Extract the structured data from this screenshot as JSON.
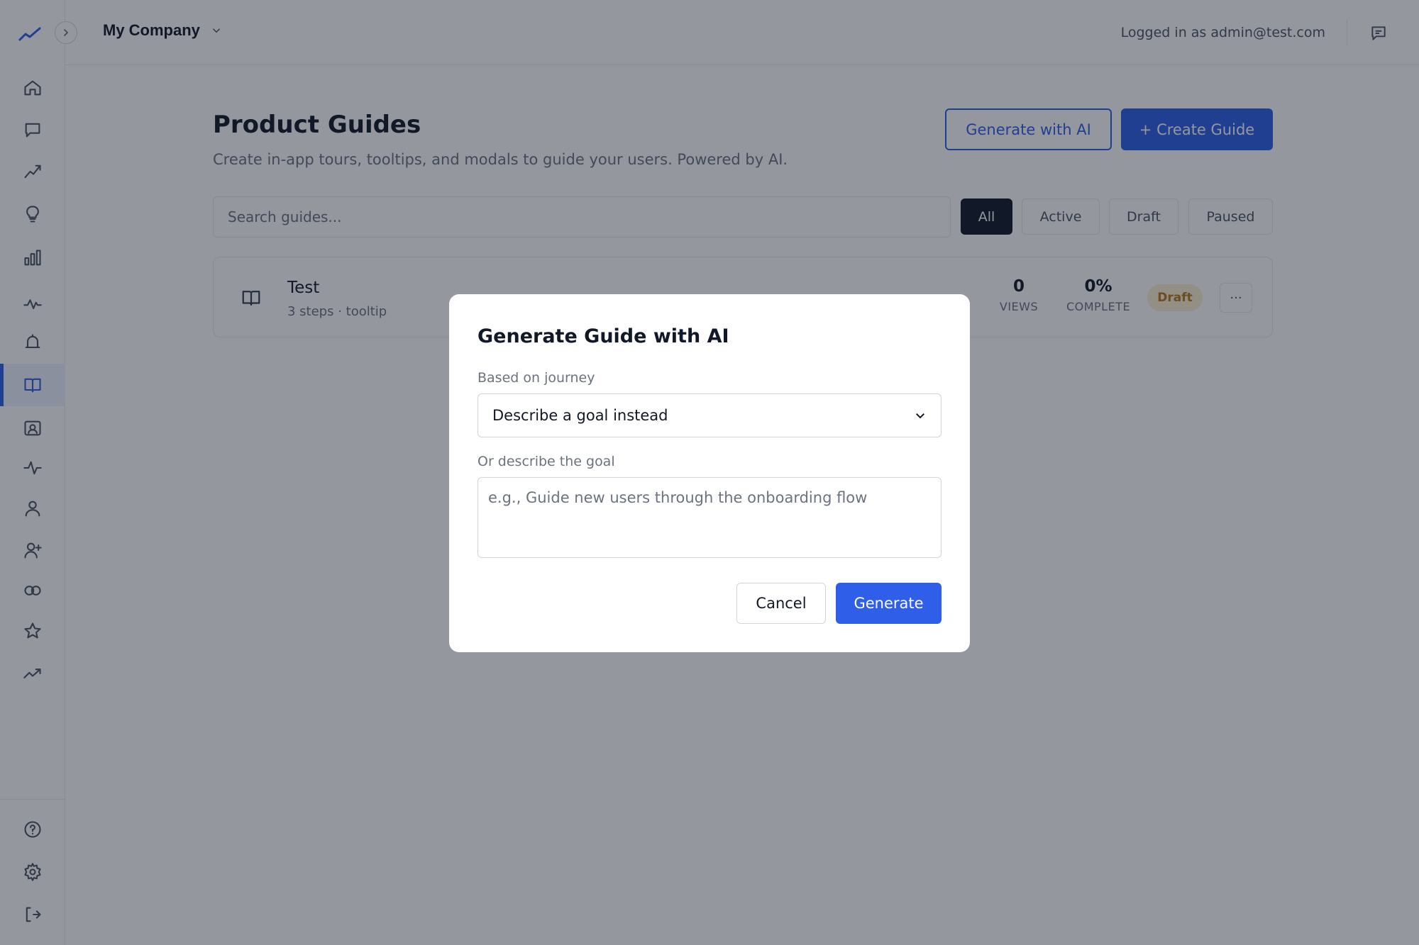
{
  "topbar": {
    "company": "My Company",
    "logged_in": "Logged in as admin@test.com"
  },
  "page": {
    "title": "Product Guides",
    "subtitle": "Create in-app tours, tooltips, and modals to guide your users. Powered by AI.",
    "generate_ai_label": "Generate with AI",
    "create_label": "+ Create Guide",
    "search_placeholder": "Search guides..."
  },
  "filters": [
    "All",
    "Active",
    "Draft",
    "Paused"
  ],
  "active_filter": "All",
  "guides": [
    {
      "name": "Test",
      "meta": "3 steps · tooltip",
      "views": "0",
      "views_label": "VIEWS",
      "complete": "0%",
      "complete_label": "COMPLETE",
      "status": "Draft"
    }
  ],
  "modal": {
    "title": "Generate Guide with AI",
    "journey_label": "Based on journey",
    "journey_selected": "Describe a goal instead",
    "goal_label": "Or describe the goal",
    "goal_placeholder": "e.g., Guide new users through the onboarding flow",
    "cancel_label": "Cancel",
    "generate_label": "Generate"
  },
  "sidebar": {
    "items": [
      {
        "icon": "home-icon"
      },
      {
        "icon": "message-icon"
      },
      {
        "icon": "trend-icon"
      },
      {
        "icon": "lightbulb-icon"
      },
      {
        "icon": "bar-chart-icon"
      },
      {
        "icon": "pulse-icon"
      },
      {
        "icon": "bell-icon"
      },
      {
        "icon": "book-icon",
        "active": true
      },
      {
        "icon": "contact-card-icon"
      },
      {
        "icon": "activity-icon"
      },
      {
        "icon": "user-icon"
      },
      {
        "icon": "user-plus-icon"
      },
      {
        "icon": "link-icon"
      },
      {
        "icon": "star-icon"
      },
      {
        "icon": "trending-up-icon"
      }
    ],
    "bottom_items": [
      {
        "icon": "help-icon"
      },
      {
        "icon": "settings-icon"
      },
      {
        "icon": "logout-icon"
      }
    ]
  },
  "colors": {
    "accent": "#2f5fe8",
    "draft_badge_bg": "#fdf0cf",
    "draft_badge_text": "#b7791f"
  }
}
